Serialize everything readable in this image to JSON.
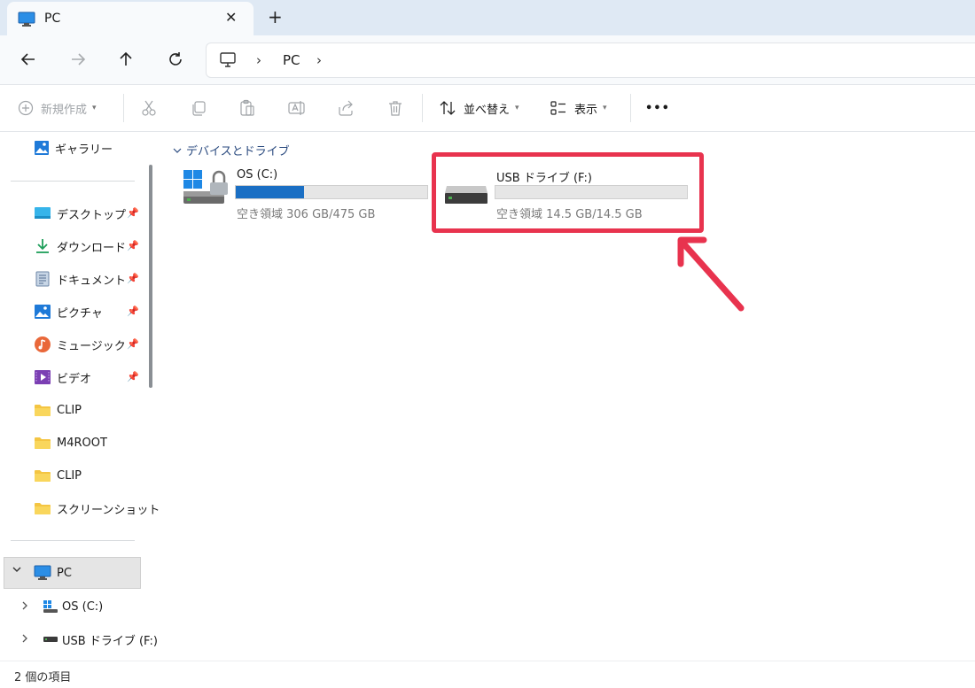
{
  "tab": {
    "title": "PC",
    "close": "✕",
    "new_tab": "+"
  },
  "address": {
    "crumb": "PC",
    "sep": "›"
  },
  "toolbar": {
    "new_label": "新規作成",
    "sort_label": "並べ替え",
    "view_label": "表示",
    "more": "•••"
  },
  "sidebar": {
    "gallery": "ギャラリー",
    "quick_access": [
      {
        "label": "デスクトップ",
        "pinned": true
      },
      {
        "label": "ダウンロード",
        "pinned": true
      },
      {
        "label": "ドキュメント",
        "pinned": true
      },
      {
        "label": "ピクチャ",
        "pinned": true
      },
      {
        "label": "ミュージック",
        "pinned": true
      },
      {
        "label": "ビデオ",
        "pinned": true
      },
      {
        "label": "CLIP",
        "pinned": false
      },
      {
        "label": "M4ROOT",
        "pinned": false
      },
      {
        "label": "CLIP",
        "pinned": false
      },
      {
        "label": "スクリーンショット",
        "pinned": false
      }
    ],
    "pc_label": "PC",
    "drives": [
      {
        "label": "OS (C:)"
      },
      {
        "label": "USB ドライブ (F:)"
      }
    ]
  },
  "content": {
    "group_header": "デバイスとドライブ",
    "drives": [
      {
        "name": "OS (C:)",
        "free_text": "空き領域 306 GB/475 GB",
        "used_fraction": 0.356
      },
      {
        "name": "USB ドライブ (F:)",
        "free_text": "空き領域 14.5 GB/14.5 GB",
        "used_fraction": 0.0
      }
    ]
  },
  "status": {
    "count": "2 個の項目"
  },
  "colors": {
    "accent": "#1a6fc4",
    "highlight": "#e8334e"
  }
}
